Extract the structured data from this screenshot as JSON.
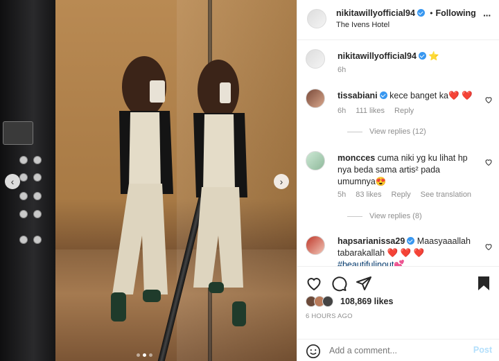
{
  "header": {
    "username": "nikitawillyofficial94",
    "separator": "•",
    "follow_label": "Following",
    "location": "The Ivens Hotel",
    "more_label": "···"
  },
  "caption": {
    "username": "nikitawillyofficial94",
    "emoji": "⭐",
    "time": "6h"
  },
  "comments": [
    {
      "username": "tissabiani",
      "verified": true,
      "text": "kece banget ka",
      "emoji": "❤️ ❤️",
      "time": "6h",
      "likes": "111 likes",
      "reply": "Reply",
      "view_replies": "View replies (12)"
    },
    {
      "username": "moncces",
      "verified": false,
      "text": "cuma niki yg ku lihat hp nya beda sama artis² pada umumnya",
      "emoji": "😍",
      "time": "5h",
      "likes": "83 likes",
      "reply": "Reply",
      "translate": "See translation",
      "view_replies": "View replies (8)"
    },
    {
      "username": "hapsarianissa29",
      "verified": true,
      "text": "Maasyaaallah tabarakallah",
      "emoji": "❤️ ❤️ ❤️",
      "hashtag": "#beautifulinout",
      "hashtag_emoji": "💕"
    }
  ],
  "post": {
    "likes": "108,869 likes",
    "age": "6 HOURS AGO",
    "comment_placeholder": "Add a comment...",
    "post_label": "Post"
  },
  "carousel": {
    "dot_count": 3,
    "active_dot": 1,
    "prev_label": "‹",
    "next_label": "›"
  },
  "colors": {
    "verified": "#3897f0",
    "link": "#00376b",
    "post_button": "#b2dffc",
    "heart": "#ed4956"
  }
}
